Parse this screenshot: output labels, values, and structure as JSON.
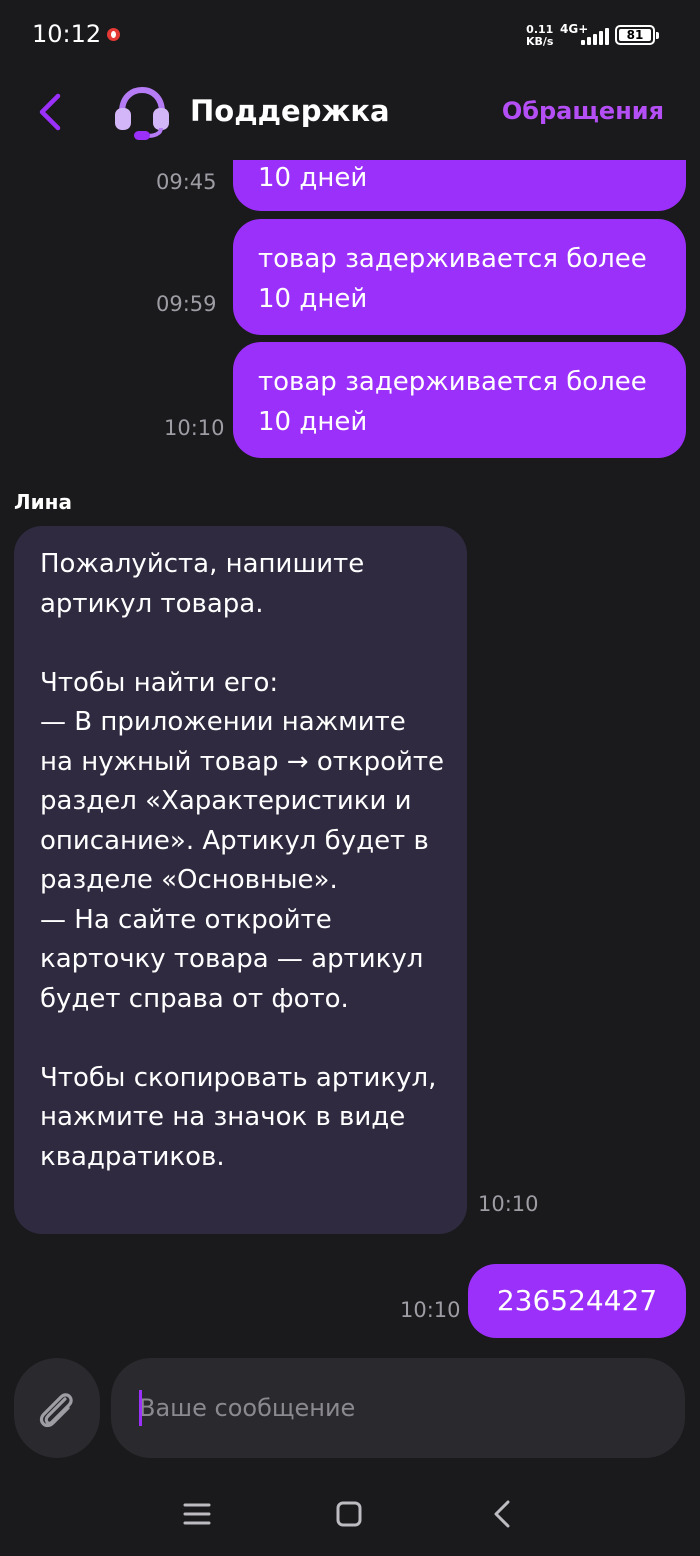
{
  "status_bar": {
    "time": "10:12",
    "net_speed_value": "0.11",
    "net_speed_unit": "KB/s",
    "network_type": "4G+",
    "battery": "81"
  },
  "header": {
    "title": "Поддержка",
    "tickets_link": "Обращения"
  },
  "messages": {
    "outgoing": [
      {
        "text": "10 дней",
        "time": "09:45"
      },
      {
        "text": "товар задерживается более 10 дней",
        "time": "09:59"
      },
      {
        "text": "товар задерживается более 10 дней",
        "time": "10:10"
      }
    ],
    "incoming": {
      "sender": "Лина",
      "paragraph1": "Пожалуйста, напишите артикул товара.",
      "paragraph2": "Чтобы найти его:\n— В приложении нажмите на нужный товар → откройте раздел «Характеристики и описание». Артикул будет в разделе «Основные».\n— На сайте откройте карточку товара — артикул будет справа от фото.",
      "paragraph3": "Чтобы скопировать артикул, нажмите на значок в виде квадратиков.",
      "time": "10:10"
    },
    "last_outgoing": {
      "text": "236524427",
      "time": "10:10"
    }
  },
  "input": {
    "placeholder": "Ваше сообщение",
    "value": ""
  },
  "colors": {
    "accent": "#9b30fa",
    "accent_text": "#b44ef5",
    "background": "#1a191c",
    "incoming_bubble": "#2f2a40"
  },
  "icons": {
    "back": "chevron-left-icon",
    "avatar": "headset-icon",
    "attach": "paperclip-icon",
    "nav_menu": "menu-icon",
    "nav_home": "square-icon",
    "nav_back": "triangle-back-icon"
  }
}
